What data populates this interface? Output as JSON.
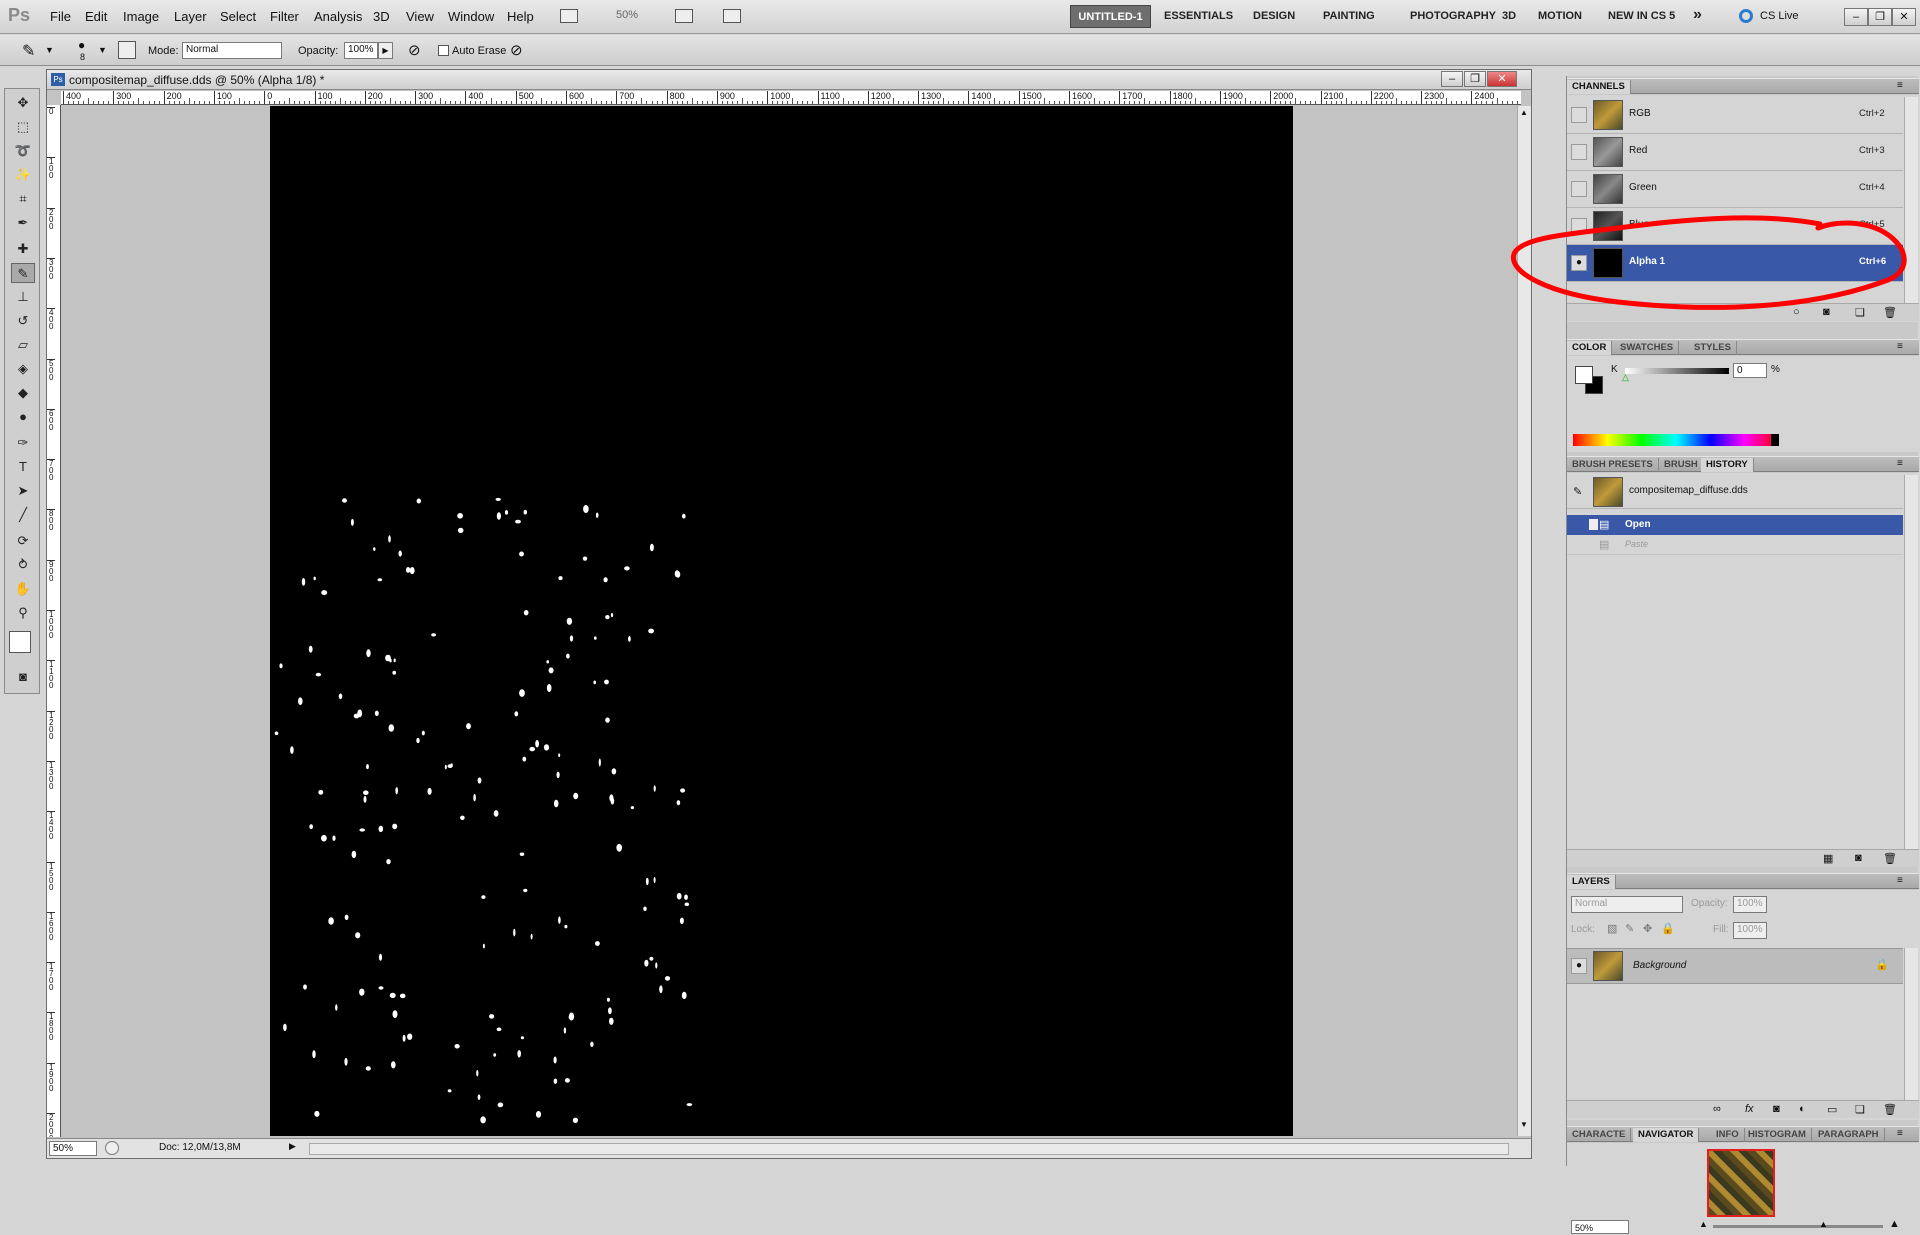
{
  "app": {
    "logo": "Ps"
  },
  "menu": {
    "items": [
      "File",
      "Edit",
      "Image",
      "Layer",
      "Select",
      "Filter",
      "Analysis",
      "3D",
      "View",
      "Window",
      "Help"
    ],
    "zoom": "50%"
  },
  "workspaces": {
    "active": "UNTITLED-1",
    "items": [
      "ESSENTIALS",
      "DESIGN",
      "PAINTING",
      "PHOTOGRAPHY",
      "3D",
      "MOTION",
      "NEW IN CS 5"
    ],
    "more": "»",
    "cslive": "CS Live"
  },
  "options": {
    "brush_size": "8",
    "mode_label": "Mode:",
    "mode_value": "Normal",
    "opacity_label": "Opacity:",
    "opacity_value": "100%",
    "auto_erase": "Auto Erase"
  },
  "document": {
    "title": "compositemap_diffuse.dds @ 50% (Alpha 1/8) *",
    "ruler_h": [
      "400",
      "300",
      "200",
      "100",
      "0",
      "100",
      "200",
      "300",
      "400",
      "500",
      "600",
      "700",
      "800",
      "900",
      "1000",
      "1100",
      "1200",
      "1300",
      "1400",
      "1500",
      "1600",
      "1700",
      "1800",
      "1900",
      "2000",
      "2100",
      "2200",
      "2300",
      "2400"
    ],
    "ruler_v": [
      "0",
      "1 0 0",
      "2 0 0",
      "3 0 0",
      "4 0 0",
      "5 0 0",
      "6 0 0",
      "7 0 0",
      "8 0 0",
      "9 0 0",
      "1 0 0 0",
      "1 1 0 0",
      "1 2 0 0",
      "1 3 0 0",
      "1 4 0 0",
      "1 5 0 0",
      "1 6 0 0",
      "1 7 0 0",
      "1 8 0 0",
      "1 9 0 0",
      "2 0 0 0"
    ]
  },
  "status": {
    "zoom": "50%",
    "doc": "Doc: 12,0M/13,8M"
  },
  "channels": {
    "tab": "CHANNELS",
    "rows": [
      {
        "name": "RGB",
        "key": "Ctrl+2"
      },
      {
        "name": "Red",
        "key": "Ctrl+3"
      },
      {
        "name": "Green",
        "key": "Ctrl+4"
      },
      {
        "name": "Blue",
        "key": "Ctrl+5"
      },
      {
        "name": "Alpha 1",
        "key": "Ctrl+6"
      }
    ]
  },
  "color": {
    "tabs": [
      "COLOR",
      "SWATCHES",
      "STYLES"
    ],
    "k_label": "K",
    "k_value": "0",
    "unit": "%"
  },
  "history": {
    "tabs": [
      "BRUSH PRESETS",
      "BRUSH",
      "HISTORY"
    ],
    "snapshot": "compositemap_diffuse.dds",
    "steps": [
      "Open",
      "Paste"
    ]
  },
  "layers": {
    "tab": "LAYERS",
    "blend": "Normal",
    "opacity_label": "Opacity:",
    "opacity_value": "100%",
    "lock_label": "Lock:",
    "fill_label": "Fill:",
    "fill_value": "100%",
    "layer_name": "Background"
  },
  "bottomtabs": {
    "tabs": [
      "CHARACTE",
      "NAVIGATOR",
      "INFO",
      "HISTOGRAM",
      "PARAGRAPH"
    ],
    "zoom": "50%"
  },
  "colors": {
    "selection": "#3959a8",
    "annotation": "#ff0000",
    "canvas": "#000000"
  }
}
